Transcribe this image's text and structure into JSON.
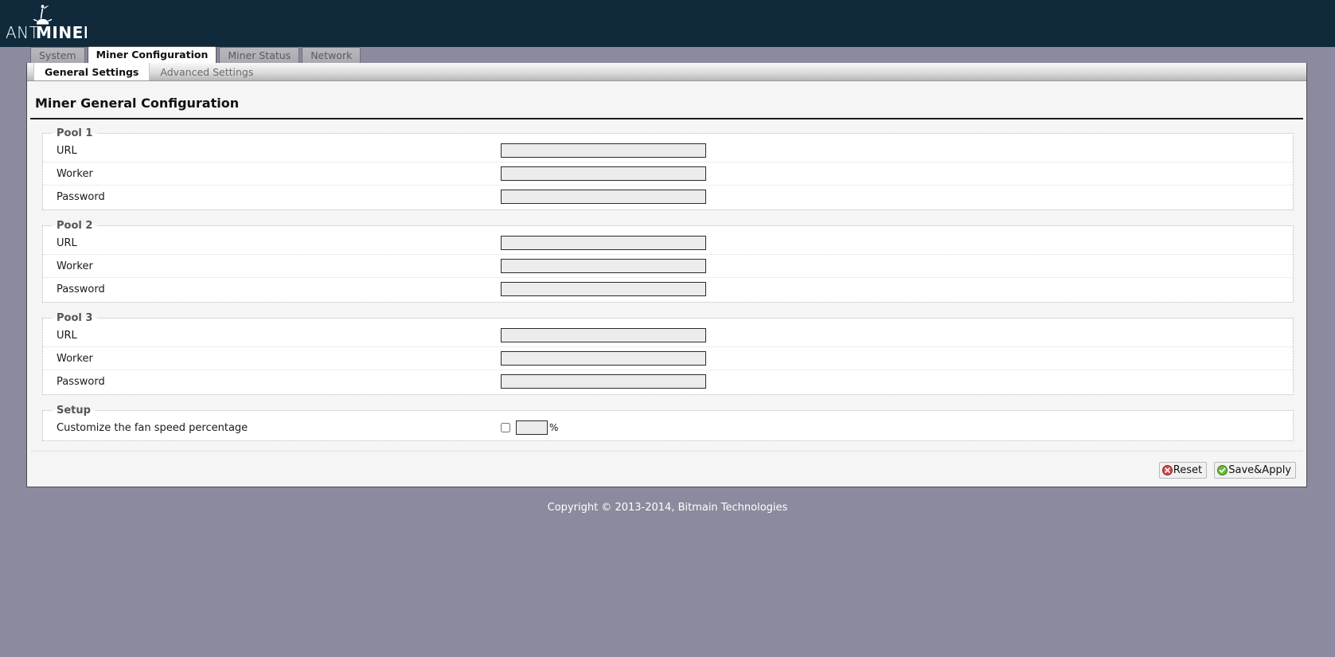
{
  "brand": {
    "name": "ANTMINER",
    "name_light": "ANT",
    "name_bold": "MINER",
    "logo_icon": "ant-logo-icon",
    "header_bg": "#102a3c"
  },
  "tabs": [
    {
      "label": "System",
      "active": false
    },
    {
      "label": "Miner Configuration",
      "active": true
    },
    {
      "label": "Miner Status",
      "active": false
    },
    {
      "label": "Network",
      "active": false
    }
  ],
  "subtabs": [
    {
      "label": "General Settings",
      "active": true
    },
    {
      "label": "Advanced Settings",
      "active": false
    }
  ],
  "page": {
    "title": "Miner General Configuration"
  },
  "pools": [
    {
      "legend": "Pool 1",
      "fields": [
        {
          "label": "URL",
          "value": "",
          "type": "text"
        },
        {
          "label": "Worker",
          "value": "",
          "type": "text"
        },
        {
          "label": "Password",
          "value": "",
          "type": "text"
        }
      ]
    },
    {
      "legend": "Pool 2",
      "fields": [
        {
          "label": "URL",
          "value": "",
          "type": "text"
        },
        {
          "label": "Worker",
          "value": "",
          "type": "text"
        },
        {
          "label": "Password",
          "value": "",
          "type": "text"
        }
      ]
    },
    {
      "legend": "Pool 3",
      "fields": [
        {
          "label": "URL",
          "value": "",
          "type": "text"
        },
        {
          "label": "Worker",
          "value": "",
          "type": "text"
        },
        {
          "label": "Password",
          "value": "",
          "type": "text"
        }
      ]
    }
  ],
  "setup": {
    "legend": "Setup",
    "fan_label": "Customize the fan speed percentage",
    "fan_checked": false,
    "fan_value": "",
    "percent_sign": "%"
  },
  "buttons": {
    "reset": {
      "label": "Reset",
      "icon": "red-x-circle-icon",
      "color": "#cf3a3a"
    },
    "save": {
      "label": "Save&Apply",
      "icon": "green-check-circle-icon",
      "color": "#5aab2e"
    }
  },
  "footer": {
    "copyright": "Copyright © 2013-2014, Bitmain Technologies"
  }
}
